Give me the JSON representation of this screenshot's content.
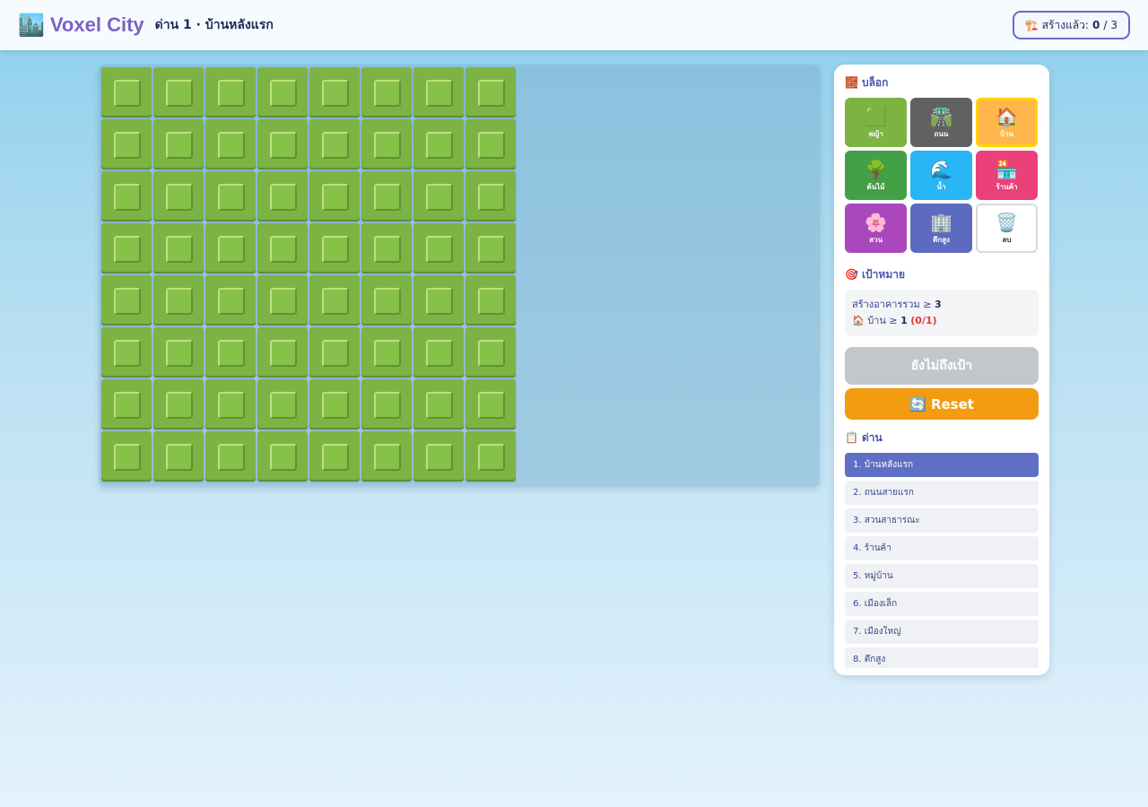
{
  "header": {
    "logo_icon": "🏙️",
    "app_title": "Voxel City",
    "level_title": "ด่าน 1 · บ้านหลังแรก",
    "counter": {
      "icon": "🏗️",
      "label": "สร้างแล้ว:",
      "built": "0",
      "separator": "/",
      "target": "3"
    }
  },
  "board": {
    "columns": 8,
    "rows": 8,
    "tile_type": "grass"
  },
  "sidebar": {
    "blocks_heading_icon": "🧱",
    "blocks_heading": "บล็อก",
    "blocks": [
      {
        "id": "grass",
        "icon": "🟩",
        "label": "หญ้า",
        "color": "#7cb342"
      },
      {
        "id": "road",
        "icon": "🛣️",
        "label": "ถนน",
        "color": "#616161"
      },
      {
        "id": "house",
        "icon": "🏠",
        "label": "บ้าน",
        "color": "#ffb74d",
        "selected": true
      },
      {
        "id": "tree",
        "icon": "🌳",
        "label": "ต้นไม้",
        "color": "#43a047"
      },
      {
        "id": "water",
        "icon": "🌊",
        "label": "น้ำ",
        "color": "#29b6f6"
      },
      {
        "id": "shop",
        "icon": "🏪",
        "label": "ร้านค้า",
        "color": "#ec407a"
      },
      {
        "id": "garden",
        "icon": "🌸",
        "label": "สวน",
        "color": "#ab47bc"
      },
      {
        "id": "tower",
        "icon": "🏢",
        "label": "ตึกสูง",
        "color": "#5c6bc0"
      },
      {
        "id": "delete",
        "icon": "🗑️",
        "label": "ลบ",
        "color": "#ffffff"
      }
    ],
    "goal_heading_icon": "🎯",
    "goal_heading": "เป้าหมาย",
    "goals": {
      "total_label": "สร้างอาคารรวม ≥",
      "total_value": "3",
      "house_icon": "🏠",
      "house_label": "บ้าน ≥",
      "house_value": "1",
      "house_progress": "(0/1)"
    },
    "goal_button": "ยังไม่ถึงเป้า",
    "reset_button": "🔄 Reset",
    "levels_heading_icon": "📋",
    "levels_heading": "ด่าน",
    "levels": [
      {
        "label": "1. บ้านหลังแรก",
        "active": true
      },
      {
        "label": "2. ถนนสายแรก"
      },
      {
        "label": "3. สวนสาธารณะ"
      },
      {
        "label": "4. ร้านค้า"
      },
      {
        "label": "5. หมู่บ้าน"
      },
      {
        "label": "6. เมืองเล็ก"
      },
      {
        "label": "7. เมืองใหญ่"
      },
      {
        "label": "8. ตึกสูง"
      }
    ]
  }
}
